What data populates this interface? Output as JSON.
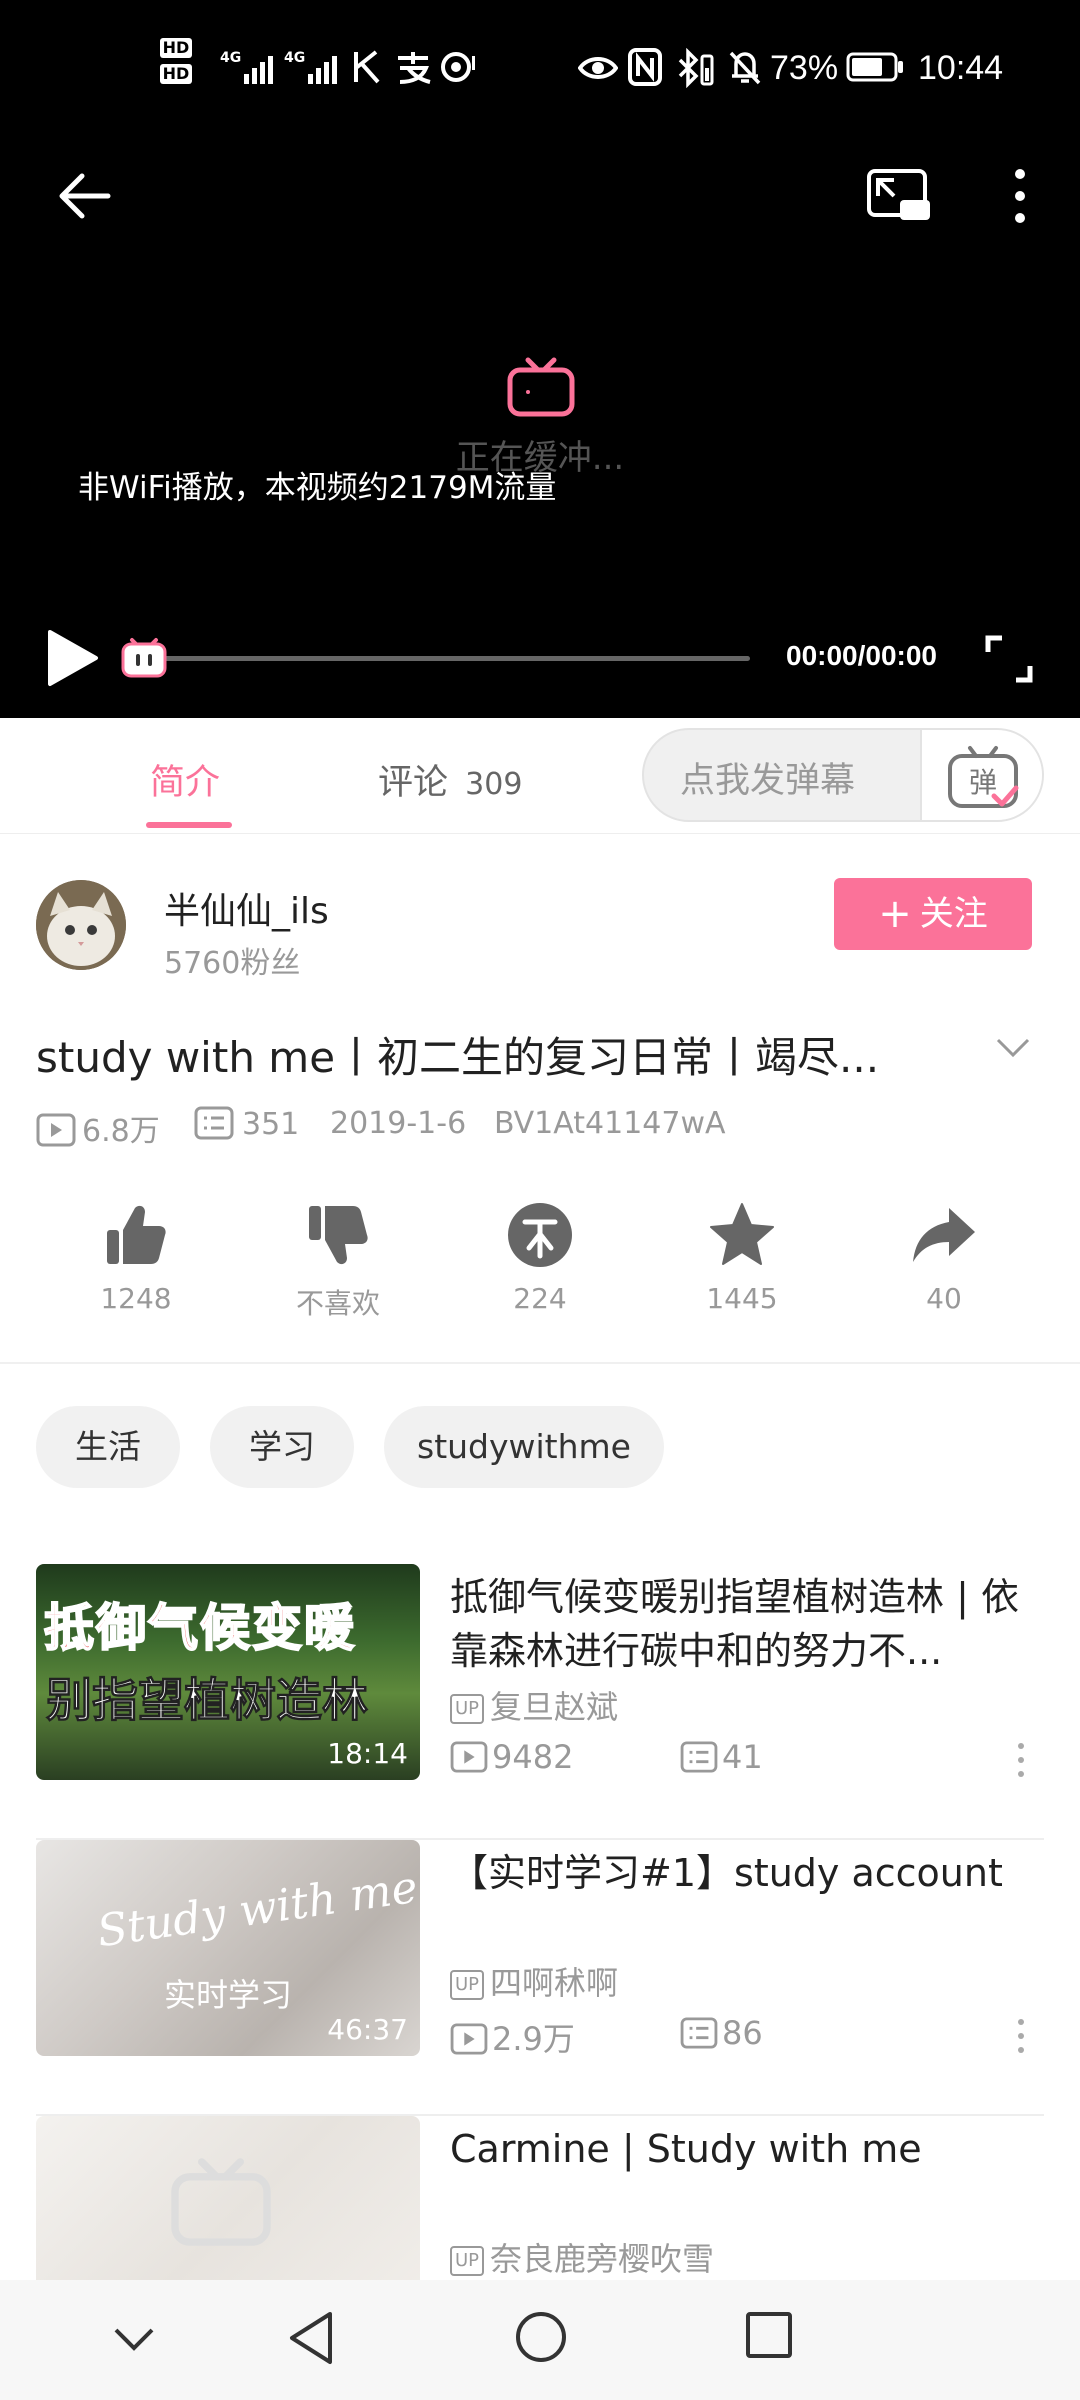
{
  "status_bar": {
    "battery_percent": "73%",
    "time": "10:44",
    "hd1": "HD",
    "hd2": "HD",
    "net1": "4G",
    "net2": "4G"
  },
  "player": {
    "buffering_text": "正在缓冲...",
    "nonwifi_tip": "非WiFi播放，本视频约2179M流量",
    "time_text": "00:00/00:00",
    "progress": 0
  },
  "tabs": {
    "intro": "简介",
    "comments": "评论",
    "comments_count": "309",
    "danmaku_placeholder": "点我发弹幕",
    "danmaku_button": "弹"
  },
  "uploader": {
    "name": "半仙仙_ils",
    "fans": "5760粉丝",
    "follow_label": "关注",
    "follow_plus": "+"
  },
  "video": {
    "title": "study with me丨初二生的复习日常丨竭尽...",
    "views": "6.8万",
    "danmaku_count": "351",
    "date": "2019-1-6",
    "bvid": "BV1At41147wA"
  },
  "actions": {
    "like": "1248",
    "dislike": "不喜欢",
    "coin": "224",
    "favorite": "1445",
    "share": "40"
  },
  "tags": [
    "生活",
    "学习",
    "studywithme"
  ],
  "recommendations": [
    {
      "title": "抵御气候变暖别指望植树造林 | 依靠森林进行碳中和的努力不...",
      "up_badge": "UP",
      "uploader": "复旦赵斌",
      "views": "9482",
      "danmaku": "41",
      "duration": "18:14",
      "thumb_text_1": "抵御气候变暖",
      "thumb_text_2": "别指望植树造林"
    },
    {
      "title": "【实时学习#1】study account",
      "up_badge": "UP",
      "uploader": "四啊秫啊",
      "views": "2.9万",
      "danmaku": "86",
      "duration": "46:37",
      "thumb_text_1": "Study with me",
      "thumb_text_2": "实时学习"
    },
    {
      "title": "Carmine | Study with me",
      "up_badge": "UP",
      "uploader": "奈良鹿旁樱吹雪",
      "views": "",
      "danmaku": "",
      "duration": ""
    }
  ],
  "colors": {
    "accent": "#fb7299",
    "player_bg": "#000000",
    "secondary_text": "#999999"
  }
}
